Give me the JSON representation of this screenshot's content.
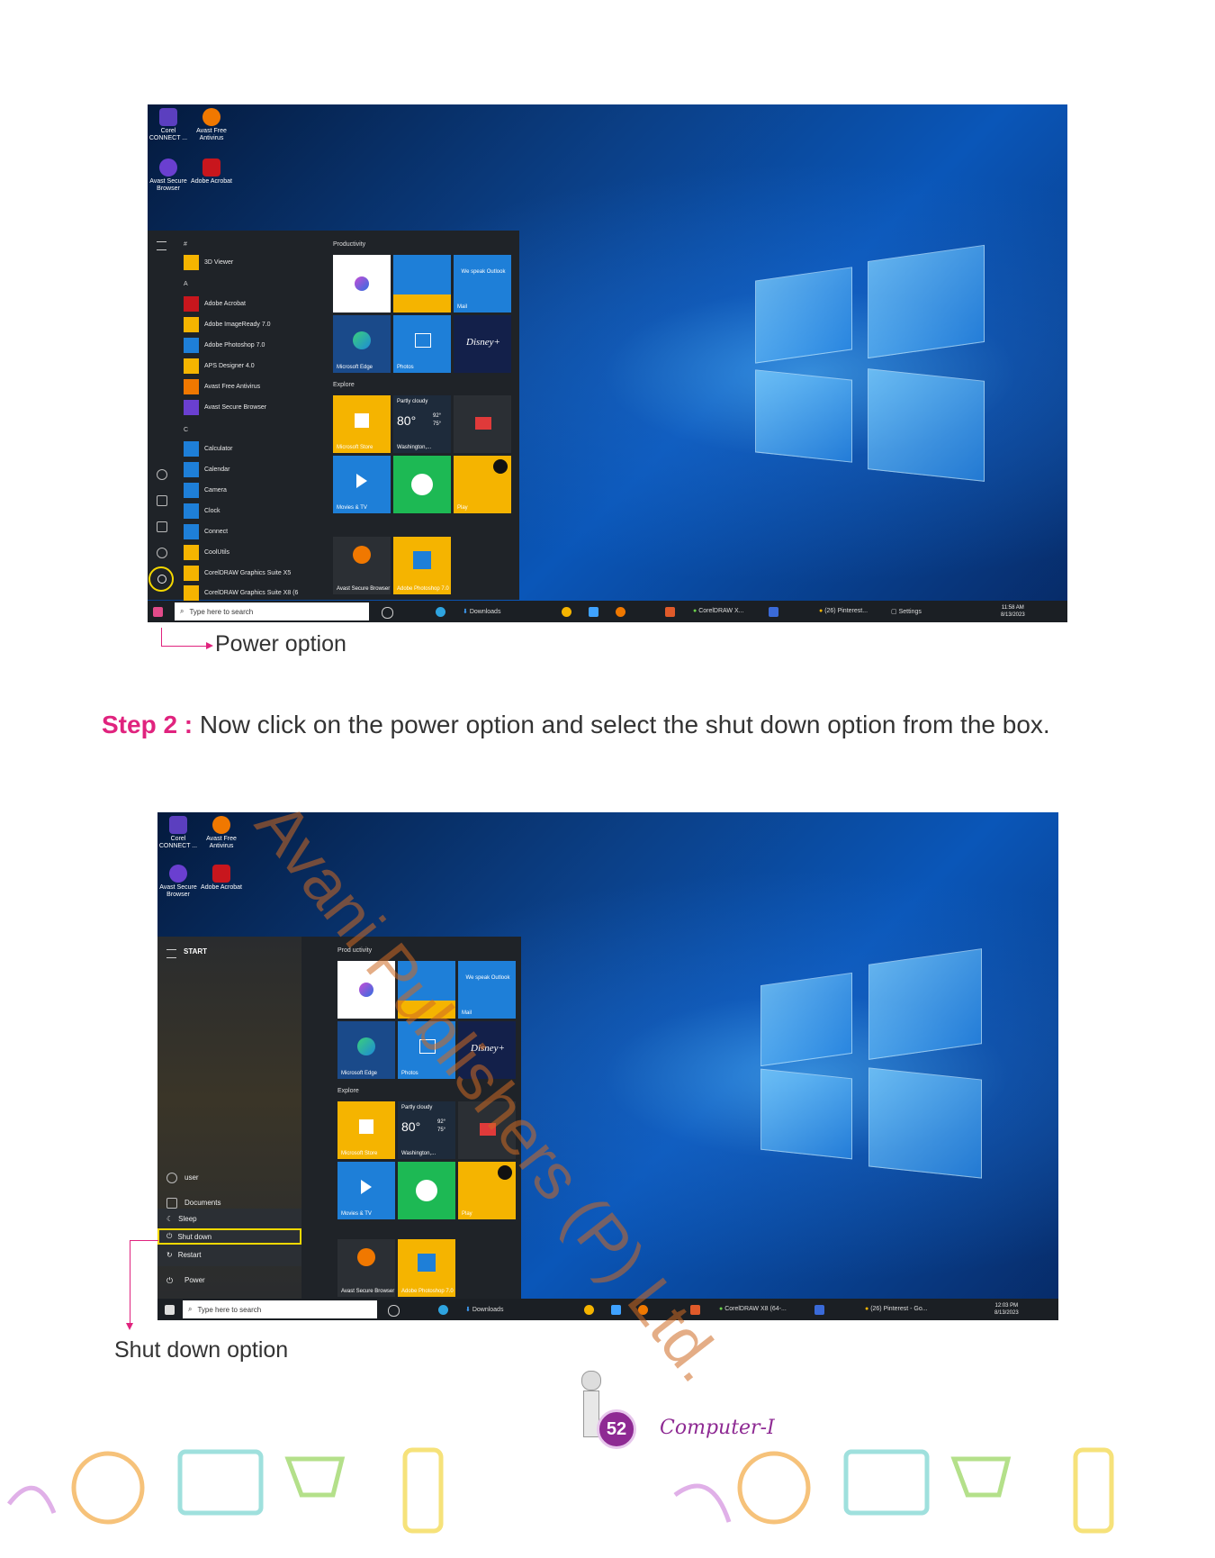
{
  "shot1": {
    "desktop_icons": [
      {
        "label": "Corel CONNECT ...",
        "color": "#5b3fbf"
      },
      {
        "label": "Avast Free Antivirus",
        "color": "#f07800"
      },
      {
        "label": "Avast Secure Browser",
        "color": "#6a3fd0"
      },
      {
        "label": "Adobe Acrobat",
        "color": "#c8161d"
      }
    ],
    "letters": [
      "#",
      "A",
      "C"
    ],
    "apps": [
      {
        "label": "3D Viewer",
        "color": "#f5b400"
      },
      {
        "label": "Adobe Acrobat",
        "color": "#c8161d"
      },
      {
        "label": "Adobe ImageReady 7.0",
        "color": "#f5b400"
      },
      {
        "label": "Adobe Photoshop 7.0",
        "color": "#1e7fd8"
      },
      {
        "label": "APS Designer 4.0",
        "color": "#f5b400"
      },
      {
        "label": "Avast Free Antivirus",
        "color": "#f07800"
      },
      {
        "label": "Avast Secure Browser",
        "color": "#6a3fd0"
      },
      {
        "label": "Calculator",
        "color": "#1e7fd8"
      },
      {
        "label": "Calendar",
        "color": "#1e7fd8"
      },
      {
        "label": "Camera",
        "color": "#1e7fd8"
      },
      {
        "label": "Clock",
        "color": "#1e7fd8"
      },
      {
        "label": "Connect",
        "color": "#1e7fd8"
      },
      {
        "label": "CoolUtils",
        "color": "#f5b400"
      },
      {
        "label": "CorelDRAW Graphics Suite X5",
        "color": "#f5b400"
      },
      {
        "label": "CorelDRAW Graphics Suite X8 (6",
        "color": "#f5b400"
      }
    ],
    "group_productivity": "Productivity",
    "group_explore": "Explore",
    "tiles": {
      "outlook": "We speak Outlook",
      "mail": "Mail",
      "edge": "Microsoft Edge",
      "photos": "Photos",
      "disney": "Disney+",
      "store": "Microsoft Store",
      "weather_cond": "Partly cloudy",
      "weather_temp": "80°",
      "weather_hi": "92°",
      "weather_lo": "75°",
      "weather_city": "Washington,...",
      "movies": "Movies & TV",
      "play": "Play",
      "avast": "Avast Secure Browser",
      "photoshop": "Adobe Photoshop 7.0"
    },
    "search_placeholder": "Type here to search",
    "taskbar": {
      "downloads": "Downloads",
      "corel": "CorelDRAW X...",
      "pinterest": "(26) Pinterest...",
      "settings": "Settings",
      "time": "11:58 AM",
      "date": "8/13/2023"
    }
  },
  "caption1": "Power option",
  "step": {
    "label": "Step 2 :",
    "text": " Now click on the power option and select the shut down option from the box."
  },
  "shot2": {
    "start_label": "START",
    "user": "user",
    "documents": "Documents",
    "power_menu": [
      "Sleep",
      "Shut down",
      "Restart"
    ],
    "power": "Power",
    "group_productivity": "Prod uctivity",
    "group_explore": "Explore",
    "tiles": {
      "outlook": "We speak Outlook",
      "mail": "Mail",
      "edge": "Microsoft Edge",
      "photos": "Photos",
      "disney": "Disney+",
      "store": "Microsoft Store",
      "weather_cond": "Partly cloudy",
      "weather_temp": "80°",
      "weather_hi": "92°",
      "weather_lo": "75°",
      "weather_city": "Washington,...",
      "movies": "Movies & TV",
      "play": "Play",
      "avast": "Avast Secure Browser",
      "photoshop": "Adobe Photoshop 7.0"
    },
    "search_placeholder": "Type here to search",
    "taskbar": {
      "downloads": "Downloads",
      "corel": "CorelDRAW X8 (64-...",
      "pinterest": "(26) Pinterest - Go...",
      "time": "12:03 PM",
      "date": "8/13/2023"
    }
  },
  "caption2": "Shut down option",
  "watermark": "Avani Publishers (P) Ltd.",
  "footer": {
    "page_number": "52",
    "book": "Computer-I"
  },
  "colors": {
    "accent_pink": "#e0237e",
    "highlight_yellow": "#f5d800",
    "tile_blue": "#1e7fd8",
    "tile_yellow": "#f5b400"
  }
}
